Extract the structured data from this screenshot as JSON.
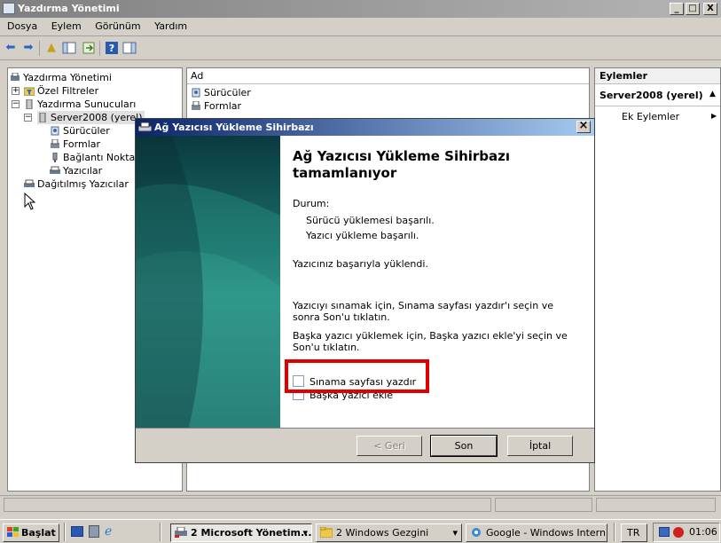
{
  "window": {
    "title": "Yazdırma Yönetimi",
    "minimize": "_",
    "maximize": "□",
    "close": "X"
  },
  "menu": [
    "Dosya",
    "Eylem",
    "Görünüm",
    "Yardım"
  ],
  "tree": {
    "root": "Yazdırma Yönetimi",
    "custom_filters": "Özel Filtreler",
    "print_servers": "Yazdırma Sunucuları",
    "server": "Server2008 (yerel)",
    "drivers": "Sürücüler",
    "forms": "Formlar",
    "ports": "Bağlantı Noktaları",
    "printers": "Yazıcılar",
    "deployed": "Dağıtılmış Yazıcılar",
    "expand": "+",
    "collapse": "−"
  },
  "list": {
    "column": "Ad",
    "items": [
      "Sürücüler",
      "Formlar"
    ]
  },
  "actions": {
    "header": "Eylemler",
    "section": "Server2008 (yerel)",
    "collapse_arrow": "▲",
    "more": "Ek Eylemler",
    "more_arrow": "▶"
  },
  "dialog": {
    "title": "Ağ Yazıcısı Yükleme Sihirbazı",
    "close": "×",
    "heading_line1": "Ağ Yazıcısı Yükleme Sihirbazı",
    "heading_line2": "tamamlanıyor",
    "status_label": "Durum:",
    "status_1": "Sürücü yüklemesi başarılı.",
    "status_2": "Yazıcı yükleme başarılı.",
    "installed_msg": "Yazıcınız başarıyla yüklendi.",
    "test_hint": "Yazıcıyı sınamak için, Sınama sayfası yazdır'ı seçin ve sonra Son'u tıklatın.",
    "add_hint": "Başka yazıcı yüklemek için, Başka yazıcı ekle'yi seçin ve Son'u tıklatın.",
    "checkbox_test": "Sınama sayfası yazdır",
    "checkbox_add": "Başka yazıcı ekle",
    "back_button": "< Geri",
    "finish_button": "Son",
    "cancel_button": "İptal"
  },
  "taskbar": {
    "start": "Başlat",
    "task1": "2 Microsoft Yönetim...",
    "task2": "2 Windows Gezgini",
    "task3": "Google - Windows Intern...",
    "dropdown_arrow": "▾",
    "language": "TR",
    "clock": "01:06"
  },
  "colors": {
    "highlight_box": "#e00000",
    "dialog_title": "#0a246a",
    "window_title_inactive": "#808080"
  }
}
